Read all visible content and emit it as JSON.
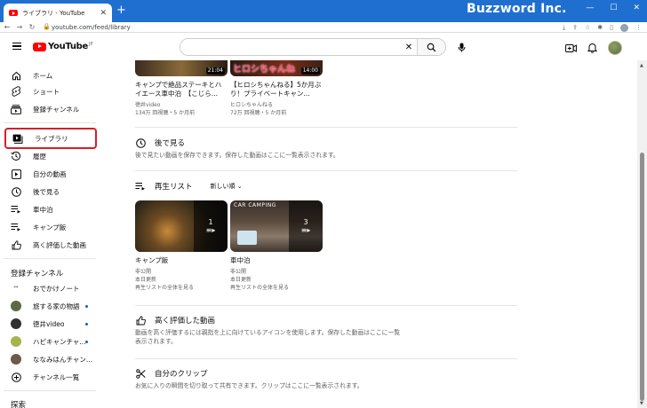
{
  "browser": {
    "tab_title": "ライブラリ - YouTube",
    "brand": "Buzzword Inc.",
    "url": "youtube.com/feed/library"
  },
  "header": {
    "logo_text": "YouTube",
    "logo_sup": "JP",
    "search_placeholder": ""
  },
  "sidebar": {
    "items": [
      {
        "label": "ホーム",
        "icon": "home-icon"
      },
      {
        "label": "ショート",
        "icon": "shorts-icon"
      },
      {
        "label": "登録チャンネル",
        "icon": "subscriptions-icon"
      },
      {
        "label": "ライブラリ",
        "icon": "library-icon",
        "active": true
      },
      {
        "label": "履歴",
        "icon": "history-icon"
      },
      {
        "label": "自分の動画",
        "icon": "your-videos-icon"
      },
      {
        "label": "後で見る",
        "icon": "watch-later-icon"
      },
      {
        "label": "車中泊",
        "icon": "playlist-icon"
      },
      {
        "label": "キャンプ飯",
        "icon": "playlist-icon"
      },
      {
        "label": "高く評価した動画",
        "icon": "like-icon"
      }
    ],
    "subs_heading": "登録チャンネル",
    "channels": [
      {
        "label": "おでかけノート",
        "live": false,
        "color": "#1b1b1b"
      },
      {
        "label": "旅する家の物語",
        "live": true,
        "color": "#5b6a44"
      },
      {
        "label": "徳井video",
        "live": true,
        "color": "#2f2f2f"
      },
      {
        "label": "ハピキャンチャ...",
        "live": true,
        "color": "#a7b34b"
      },
      {
        "label": "ななみはんチャン...",
        "live": false,
        "color": "#6d5a4b"
      }
    ],
    "all_channels": "チャンネル一覧",
    "explore_heading": "探索"
  },
  "videos": [
    {
      "title": "キャンプで絶品ステーキとハイエース車中泊　【こじら...",
      "channel": "徳井video",
      "meta": "134万 回視聴・5 か月前",
      "duration": "21:04",
      "colors": [
        "#3b2c1e",
        "#8a6a3a"
      ]
    },
    {
      "title": "【ヒロシちゃんねる】5か月ぶり！プライベートキャン...",
      "channel": "ヒロシちゃんねる",
      "meta": "72万 回視聴・5 か月前",
      "duration": "14:00",
      "thumb_text": "ヒロシちゃんね",
      "colors": [
        "#2a1a12",
        "#c24a2a"
      ]
    }
  ],
  "watch_later": {
    "title": "後で見る",
    "desc": "後で見たい動画を保存できます。保存した動画はここに一覧表示されます。"
  },
  "playlists": {
    "title": "再生リスト",
    "sort": "新しい順",
    "items": [
      {
        "title": "キャンプ飯",
        "privacy": "非公開",
        "updated": "本日更新",
        "view_all": "再生リストの全体を見る",
        "count": "1",
        "overlay_text": ""
      },
      {
        "title": "車中泊",
        "privacy": "非公開",
        "updated": "本日更新",
        "view_all": "再生リストの全体を見る",
        "count": "3",
        "overlay_text": "CAR CAMPING"
      }
    ]
  },
  "liked": {
    "title": "高く評価した動画",
    "desc": "動画を高く評価するには親指を上に向けているアイコンを使用します。保存した動画はここに一覧表示されます。"
  },
  "clips": {
    "title": "自分のクリップ",
    "desc": "お気に入りの瞬間を切り取って共有できます。クリップはここに一覧表示されます。"
  }
}
